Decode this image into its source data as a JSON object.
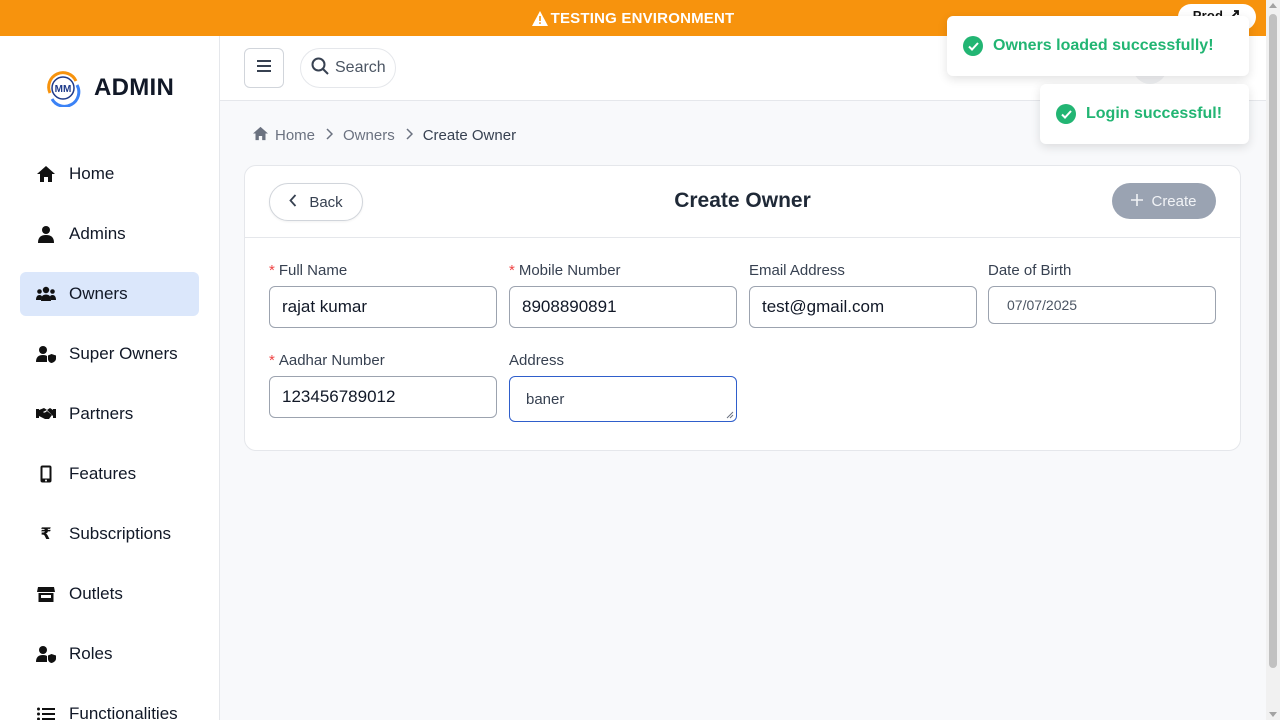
{
  "banner": {
    "text": "TESTING ENVIRONMENT",
    "prod_label": "Prod"
  },
  "brand": {
    "logo_text": "MM",
    "title": "ADMIN"
  },
  "sidebar": {
    "items": [
      {
        "label": "Home",
        "icon": "home-icon"
      },
      {
        "label": "Admins",
        "icon": "user-icon"
      },
      {
        "label": "Owners",
        "icon": "users-icon",
        "active": true
      },
      {
        "label": "Super Owners",
        "icon": "user-shield-icon"
      },
      {
        "label": "Partners",
        "icon": "handshake-icon"
      },
      {
        "label": "Features",
        "icon": "mobile-icon"
      },
      {
        "label": "Subscriptions",
        "icon": "rupee-icon"
      },
      {
        "label": "Outlets",
        "icon": "store-icon"
      },
      {
        "label": "Roles",
        "icon": "user-shield-icon"
      },
      {
        "label": "Functionalities",
        "icon": "list-icon"
      }
    ]
  },
  "header": {
    "search_label": "Search"
  },
  "breadcrumb": {
    "home": "Home",
    "owners": "Owners",
    "current": "Create Owner"
  },
  "card": {
    "back_label": "Back",
    "title": "Create Owner",
    "create_label": "Create"
  },
  "form": {
    "full_name": {
      "label": "Full Name",
      "value": "rajat kumar",
      "required": true
    },
    "mobile": {
      "label": "Mobile Number",
      "value": "8908890891",
      "required": true
    },
    "email": {
      "label": "Email Address",
      "value": "test@gmail.com"
    },
    "dob": {
      "label": "Date of Birth",
      "value": "07/07/2025"
    },
    "aadhar": {
      "label": "Aadhar Number",
      "value": "123456789012",
      "required": true
    },
    "address": {
      "label": "Address",
      "value": "baner"
    }
  },
  "toasts": [
    {
      "text": "Owners loaded successfully!"
    },
    {
      "text": "Login successful!"
    }
  ],
  "colors": {
    "banner": "#f7930d",
    "active_nav": "#dbe7fb",
    "success": "#22b573",
    "create_btn": "#9aa3b2",
    "focus": "#2f5ecb"
  }
}
